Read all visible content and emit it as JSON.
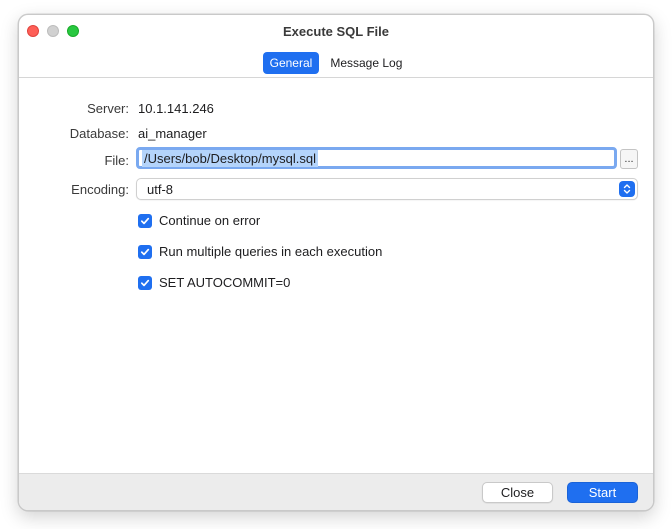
{
  "window": {
    "title": "Execute SQL File"
  },
  "tabs": [
    {
      "label": "General",
      "active": true
    },
    {
      "label": "Message Log",
      "active": false
    }
  ],
  "form": {
    "server_label": "Server:",
    "server_value": "10.1.141.246",
    "database_label": "Database:",
    "database_value": "ai_manager",
    "file_label": "File:",
    "file_value": "/Users/bob/Desktop/mysql.sql",
    "browse_label": "...",
    "encoding_label": "Encoding:",
    "encoding_value": "utf-8"
  },
  "options": [
    {
      "label": "Continue on error",
      "checked": true
    },
    {
      "label": "Run multiple queries in each execution",
      "checked": true
    },
    {
      "label": "SET AUTOCOMMIT=0",
      "checked": true
    }
  ],
  "footer": {
    "close_label": "Close",
    "start_label": "Start"
  },
  "colors": {
    "accent": "#1f6ff0",
    "selection": "#b4d4fb",
    "focus_ring": "#7aa9f0"
  }
}
